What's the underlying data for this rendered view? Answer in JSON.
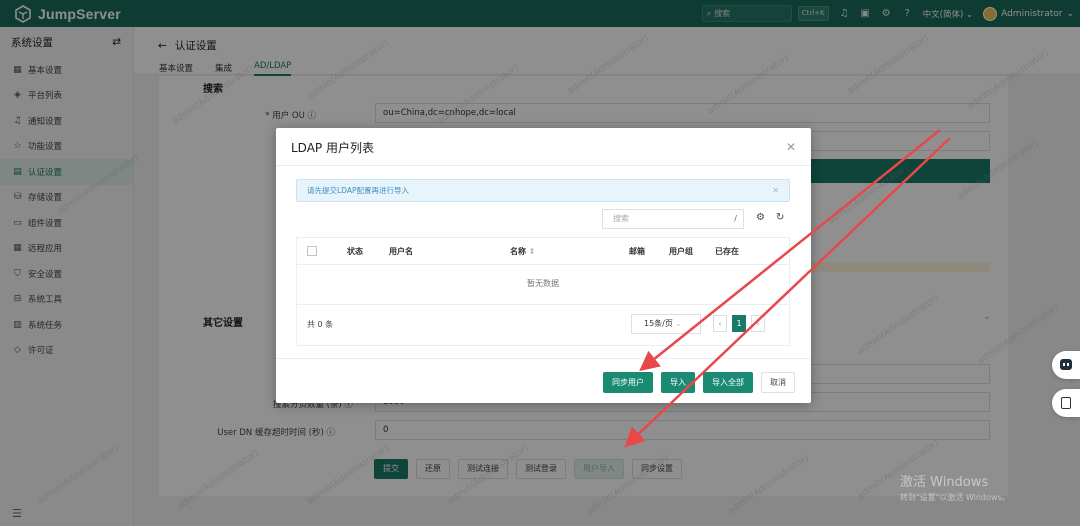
{
  "app": {
    "name": "JumpServer"
  },
  "topbar": {
    "search_placeholder": "搜索",
    "shortcut": "Ctrl+K",
    "language": "中文(简体)",
    "user": "Administrator"
  },
  "sidebar": {
    "title": "系统设置",
    "items": [
      {
        "label": "基本设置",
        "icon": "grid-icon"
      },
      {
        "label": "平台列表",
        "icon": "cube-icon"
      },
      {
        "label": "通知设置",
        "icon": "bell-icon"
      },
      {
        "label": "功能设置",
        "icon": "star-icon"
      },
      {
        "label": "认证设置",
        "icon": "id-card-icon",
        "active": true
      },
      {
        "label": "存储设置",
        "icon": "database-icon"
      },
      {
        "label": "组件设置",
        "icon": "monitor-icon"
      },
      {
        "label": "远程应用",
        "icon": "apps-icon"
      },
      {
        "label": "安全设置",
        "icon": "shield-icon"
      },
      {
        "label": "系统工具",
        "icon": "toolbox-icon"
      },
      {
        "label": "系统任务",
        "icon": "task-icon"
      },
      {
        "label": "许可证",
        "icon": "license-icon"
      }
    ]
  },
  "page": {
    "title": "认证设置",
    "tabs": [
      "基本设置",
      "集成",
      "AD/LDAP"
    ],
    "active_tab": "AD/LDAP"
  },
  "form": {
    "section_search": "搜索",
    "user_ou_label": "* 用户 OU",
    "user_ou_value": "ou=China,dc=cnhope,dc=local",
    "section_other": "其它设置",
    "page_size_label": "搜索分页数量 (条)",
    "page_size_value": "1000",
    "cache_timeout_label": "User DN 缓存超时时间 (秒)",
    "cache_timeout_value": "0",
    "buttons": [
      "提交",
      "还原",
      "测试连接",
      "测试登录",
      "用户导入",
      "同步设置"
    ]
  },
  "dialog": {
    "title": "LDAP 用户列表",
    "alert": "请先提交LDAP配置再进行导入",
    "search_placeholder": "搜索",
    "search_slash": "/",
    "columns": [
      "状态",
      "用户名",
      "名称",
      "邮箱",
      "用户组",
      "已存在"
    ],
    "empty_text": "暂无数据",
    "total": "共 0 条",
    "page_size": "15条/页",
    "current_page": "1",
    "buttons": {
      "sync": "同步用户",
      "import": "导入",
      "import_all": "导入全部",
      "cancel": "取消"
    }
  },
  "watermark": "admin(Administrator)",
  "windows_watermark": {
    "line1": "激活 Windows",
    "line2": "转到\"设置\"以激活 Windows。"
  },
  "colors": {
    "brand": "#1a6b5a",
    "primary_button": "#1a8a73",
    "annotation_arrow": "#e8484a"
  }
}
